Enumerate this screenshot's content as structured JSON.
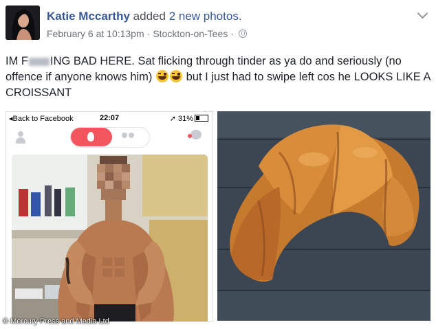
{
  "post": {
    "author_name": "Katie Mccarthy",
    "action_text": "added",
    "action_count": "2 new photos.",
    "date": "February 6 at 10:13pm",
    "separator": "·",
    "location": "Stockton-on-Tees",
    "separator2": "·",
    "privacy_icon": "globe-icon",
    "options_icon": "chevron-down-icon",
    "text_part1": "IM F",
    "text_part2": "ING BAD HERE. Sat flicking through tinder as ya do and seriously (no offence if anyone knows him)",
    "emoji": "face-with-tears-of-joy-icon",
    "text_part3": "but I just had to swipe left cos he LOOKS LIKE A CROISSANT"
  },
  "tinder_screenshot": {
    "back_label": "Back to Facebook",
    "time": "22:07",
    "battery": "31%",
    "profile_icon": "person-icon",
    "flame_icon": "flame-icon",
    "group_icon": "group-icon",
    "chat_icon": "chat-icon",
    "accent_color": "#f2555e"
  },
  "watermark": "© Mercury Press and Media Ltd"
}
